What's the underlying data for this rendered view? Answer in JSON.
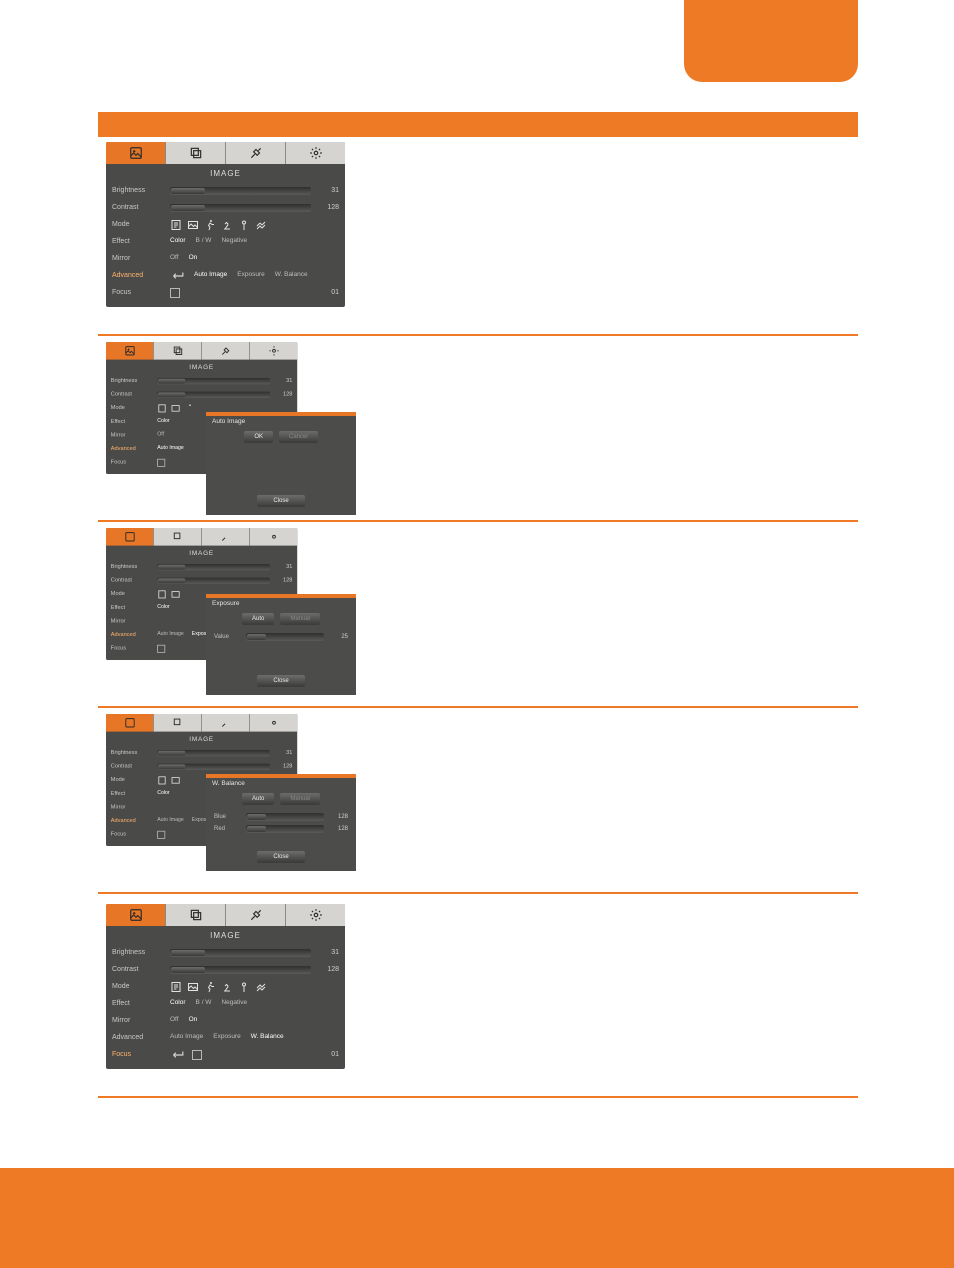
{
  "osd": {
    "title": "IMAGE",
    "tabs": [
      "image",
      "capture",
      "tools",
      "settings"
    ],
    "rows": {
      "brightness": {
        "label": "Brightness",
        "value": "31"
      },
      "contrast": {
        "label": "Contrast",
        "value": "128"
      },
      "mode": {
        "label": "Mode"
      },
      "effect": {
        "label": "Effect",
        "color": "Color",
        "bw": "B / W",
        "negative": "Negative"
      },
      "mirror": {
        "label": "Mirror",
        "off": "Off",
        "on": "On"
      },
      "advanced": {
        "label": "Advanced",
        "auto_image": "Auto Image",
        "exposure": "Exposure",
        "wbalance": "W. Balance"
      },
      "focus": {
        "label": "Focus",
        "value": "01"
      }
    }
  },
  "popups": {
    "auto_image": {
      "title": "Auto Image",
      "ok": "OK",
      "cancel": "Cancel",
      "close": "Close"
    },
    "exposure": {
      "title": "Exposure",
      "auto": "Auto",
      "manual": "Manual",
      "value_label": "Value",
      "value": "25",
      "close": "Close"
    },
    "wbalance": {
      "title": "W. Balance",
      "auto": "Auto",
      "manual": "Manual",
      "blue_label": "Blue",
      "blue": "128",
      "red_label": "Red",
      "red": "128",
      "close": "Close"
    }
  }
}
